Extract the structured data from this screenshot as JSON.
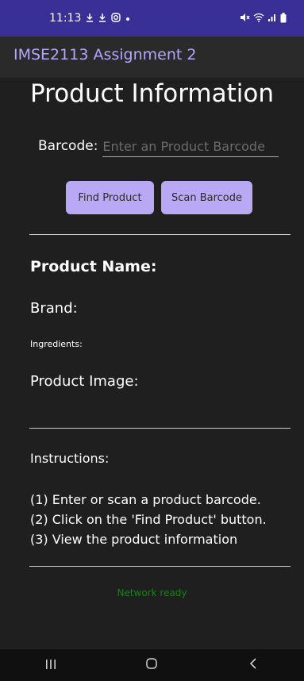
{
  "status_bar": {
    "time": "11:13",
    "left_icons": [
      "download-icon",
      "download-icon",
      "instagram-icon",
      "dot-icon"
    ],
    "right_icons": [
      "mute-icon",
      "wifi-icon",
      "signal-icon",
      "battery-icon"
    ]
  },
  "app_bar": {
    "title": "IMSE2113 Assignment 2"
  },
  "page": {
    "title": "Product Information"
  },
  "barcode": {
    "label": "Barcode:",
    "value": "",
    "placeholder": "Enter an Product Barcode"
  },
  "buttons": {
    "find_label": "Find Product",
    "scan_label": "Scan Barcode"
  },
  "product": {
    "name_label": "Product Name:",
    "brand_label": "Brand:",
    "ingredients_label": "Ingredients:",
    "image_label": "Product Image:"
  },
  "instructions": {
    "title": "Instructions:",
    "steps": [
      "(1) Enter or scan a product barcode.",
      "(2) Click on the 'Find Product' button.",
      "(3) View the product information"
    ]
  },
  "network": {
    "status": "Network ready"
  },
  "colors": {
    "status_bar": "#3a2f96",
    "app_title": "#b3a6ff",
    "button": "#b9a8f4",
    "network_text": "#1b7f1b",
    "background": "#1f1f1f"
  },
  "nav_bar": {
    "icons": [
      "recent-apps-icon",
      "home-icon",
      "back-icon"
    ]
  }
}
